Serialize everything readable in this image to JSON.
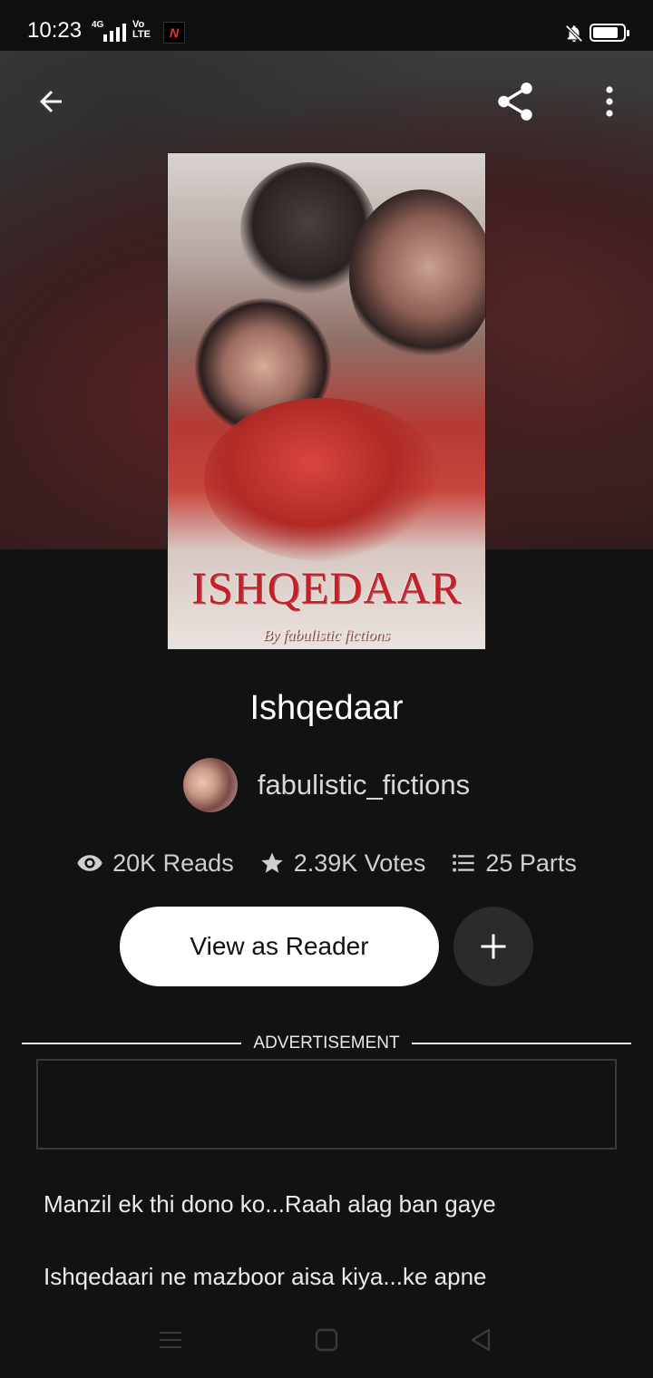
{
  "status_bar": {
    "time": "10:23",
    "network": "4G",
    "volte": "Vo LTE",
    "app_icon": "N",
    "battery_level": 0.85
  },
  "toolbar": {
    "back_icon": "arrow-left-icon",
    "share_icon": "share-icon",
    "more_icon": "more-vertical-icon"
  },
  "cover": {
    "title": "ISHQEDAAR",
    "byline": "By fabulistic fictions"
  },
  "story": {
    "title": "Ishqedaar",
    "author": "fabulistic_fictions",
    "stats": {
      "reads": "20K Reads",
      "votes": "2.39K Votes",
      "parts": "25 Parts"
    },
    "primary_action": "View as Reader",
    "description_lines": [
      "Manzil ek thi dono ko...Raah alag ban gaye",
      "Ishqedaari ne mazboor aisa kiya...ke apne"
    ]
  },
  "advertisement": {
    "label": "ADVERTISEMENT"
  },
  "colors": {
    "background": "#121212",
    "button_primary": "#ffffff",
    "button_secondary": "#2b2b2b",
    "cover_title": "#c4202a"
  }
}
